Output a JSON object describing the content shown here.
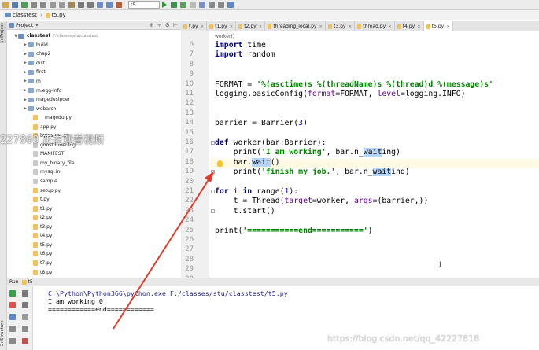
{
  "toolbar": {
    "run_config": "t5"
  },
  "breadcrumb": {
    "project": "classtest",
    "file": "t5.py"
  },
  "left_strip": {
    "project_tab": "1: Project",
    "structure_tab": "2: Structure"
  },
  "project_panel": {
    "header": "Project",
    "root_label": "classtest",
    "root_path": "F:\\classes\\stu\\classtest",
    "items": [
      {
        "label": "build",
        "kind": "folder"
      },
      {
        "label": "chap2",
        "kind": "folder"
      },
      {
        "label": "dist",
        "kind": "folder"
      },
      {
        "label": "first",
        "kind": "folder"
      },
      {
        "label": "m",
        "kind": "folder"
      },
      {
        "label": "m.egg-info",
        "kind": "folder"
      },
      {
        "label": "magedusipder",
        "kind": "folder"
      },
      {
        "label": "webarch",
        "kind": "folder"
      },
      {
        "label": "__magedu.py",
        "kind": "py"
      },
      {
        "label": "app.py",
        "kind": "py"
      },
      {
        "label": "bytestest.py",
        "kind": "py"
      },
      {
        "label": "ghostdriver.log",
        "kind": "txt"
      },
      {
        "label": "MANIFEST",
        "kind": "txt"
      },
      {
        "label": "my_binary_file",
        "kind": "txt"
      },
      {
        "label": "mysql.ini",
        "kind": "txt"
      },
      {
        "label": "sample",
        "kind": "txt"
      },
      {
        "label": "setup.py",
        "kind": "py"
      },
      {
        "label": "t.py",
        "kind": "py"
      },
      {
        "label": "t1.py",
        "kind": "py"
      },
      {
        "label": "t2.py",
        "kind": "py"
      },
      {
        "label": "t3.py",
        "kind": "py"
      },
      {
        "label": "t4.py",
        "kind": "py"
      },
      {
        "label": "t5.py",
        "kind": "py"
      },
      {
        "label": "t6.py",
        "kind": "py"
      },
      {
        "label": "t7.py",
        "kind": "py"
      },
      {
        "label": "t8.py",
        "kind": "py"
      }
    ]
  },
  "editor_tabs": [
    {
      "label": "t.py",
      "active": false
    },
    {
      "label": "t1.py",
      "active": false
    },
    {
      "label": "t2.py",
      "active": false
    },
    {
      "label": "threading_local.py",
      "active": false
    },
    {
      "label": "t3.py",
      "active": false
    },
    {
      "label": "thread.py",
      "active": false
    },
    {
      "label": "t4.py",
      "active": false
    },
    {
      "label": "t5.py",
      "active": true
    }
  ],
  "editor": {
    "breadcrumb": "worker()",
    "lines": [
      {
        "n": "6",
        "text": "import time"
      },
      {
        "n": "7",
        "text": "import random"
      },
      {
        "n": "8",
        "text": ""
      },
      {
        "n": "9",
        "text": ""
      },
      {
        "n": "10",
        "text": "FORMAT = '%(asctime)s %(threadName)s %(thread)d %(message)s'"
      },
      {
        "n": "11",
        "text": "logging.basicConfig(format=FORMAT, level=logging.INFO)"
      },
      {
        "n": "12",
        "text": ""
      },
      {
        "n": "13",
        "text": ""
      },
      {
        "n": "14",
        "text": "barrier = Barrier(3)"
      },
      {
        "n": "15",
        "text": ""
      },
      {
        "n": "16",
        "text": "def worker(bar:Barrier):"
      },
      {
        "n": "17",
        "text": "    print('I am working', bar.n_waiting)"
      },
      {
        "n": "18",
        "text": "    bar.wait()"
      },
      {
        "n": "19",
        "text": "    print('finish my job.', bar.n_waiting)"
      },
      {
        "n": "20",
        "text": ""
      },
      {
        "n": "21",
        "text": "for i in range(1):"
      },
      {
        "n": "22",
        "text": "    t = Thread(target=worker, args=(barrier,))"
      },
      {
        "n": "23",
        "text": "    t.start()"
      },
      {
        "n": "24",
        "text": ""
      },
      {
        "n": "25",
        "text": "print('===========end===========')"
      },
      {
        "n": "26",
        "text": ""
      },
      {
        "n": "27",
        "text": ""
      },
      {
        "n": "28",
        "text": ""
      },
      {
        "n": "29",
        "text": ""
      },
      {
        "n": "30",
        "text": ""
      }
    ]
  },
  "run_panel": {
    "header_label": "Run",
    "config": "t5",
    "output": [
      "C:\\Python\\Python366\\python.exe F:/classes/stu/classtest/t5.py",
      "I am working 0",
      "============end============"
    ]
  },
  "overlay": {
    "watermark_left": "227869 正在观看视频",
    "watermark_bottom": "https://blog.csdn.net/qq_42227818"
  },
  "colors": {
    "keyword": "#000080",
    "string": "#008000",
    "number": "#0000ff",
    "kwarg": "#660099",
    "arrow": "#e23b2e",
    "selection": "#b5d5ff"
  }
}
